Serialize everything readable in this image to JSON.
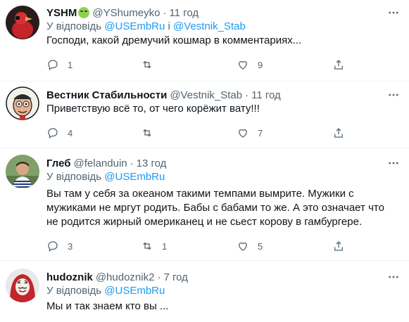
{
  "tweets": [
    {
      "name": "YSHM",
      "handle": "@YShumeyko",
      "dot": "·",
      "time": "11 год",
      "reply_prefix": "У відповідь",
      "reply_mention_1": "@USEmbRu",
      "reply_joiner": "і",
      "reply_mention_2": "@Vestnik_Stab",
      "text": "Господи, какой дремучий кошмар в комментариях...",
      "replies": "1",
      "retweets": "",
      "likes": "9"
    },
    {
      "name": "Вестник Стабильности",
      "handle": "@Vestnik_Stab",
      "dot": "·",
      "time": "11 год",
      "text": "Приветствую всё то, от чего корёжит вату!!!",
      "replies": "4",
      "retweets": "",
      "likes": "7"
    },
    {
      "name": "Глеб",
      "handle": "@felanduin",
      "dot": "·",
      "time": "13 год",
      "reply_prefix": "У відповідь",
      "reply_mention_1": "@USEmbRu",
      "text": "Вы там у себя за океаном такими темпами вымрите. Мужики с мужиками не мргут родить. Бабы с бабами то же. А это означает что не родится жирный омериканец и не сьест корову в гамбургере.",
      "replies": "3",
      "retweets": "1",
      "likes": "5"
    },
    {
      "name": "hudoznik",
      "handle": "@hudoznik2",
      "dot": "·",
      "time": "7 год",
      "reply_prefix": "У відповідь",
      "reply_mention_1": "@USEmbRu",
      "text": "Мы и так знаем кто вы ..."
    }
  ],
  "colors": {
    "text": "#0f1419",
    "muted": "#536471",
    "link": "#1d9bf0",
    "divider": "#eff3f4"
  },
  "icons": [
    "more-icon",
    "reply-icon",
    "retweet-icon",
    "like-icon",
    "share-icon"
  ]
}
